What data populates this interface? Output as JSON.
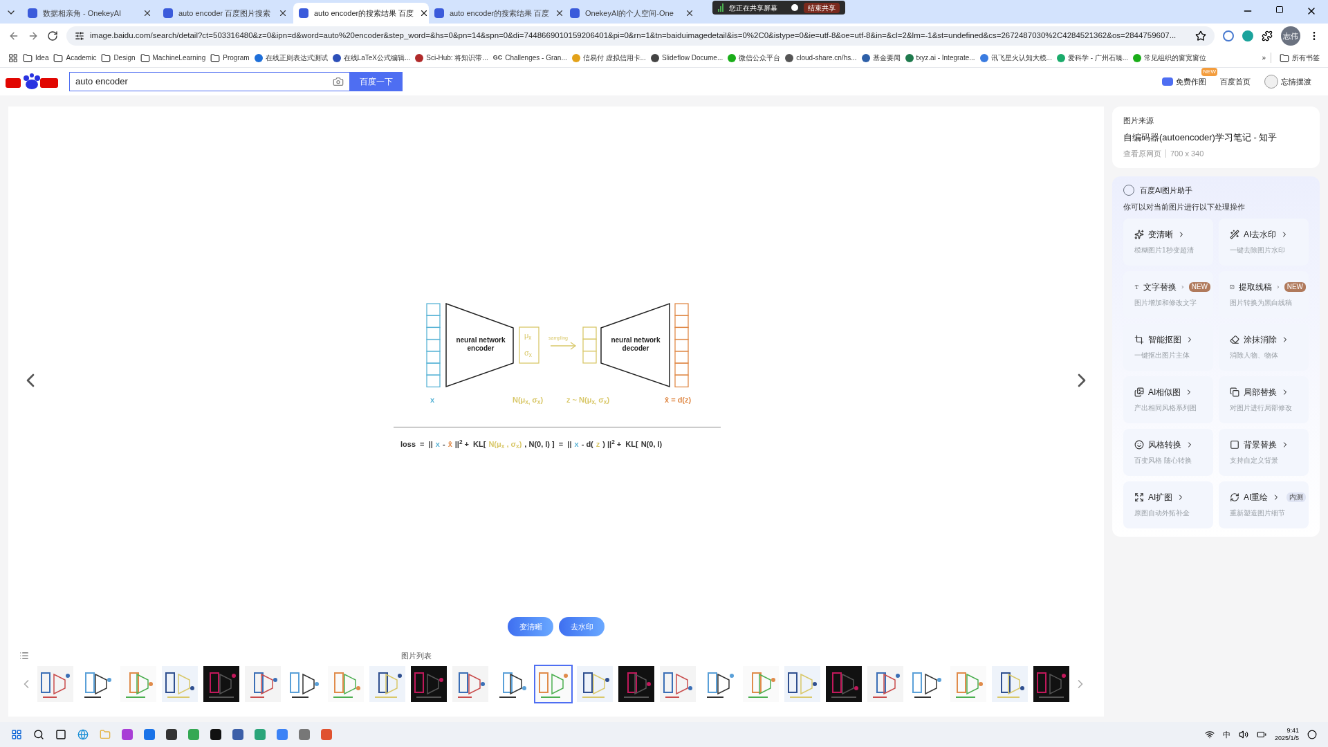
{
  "tabs": [
    {
      "title": "数据相亲角 - OnekeyAI",
      "selected": false
    },
    {
      "title": "auto encoder 百度图片搜索",
      "selected": false
    },
    {
      "title": "auto encoder的搜索结果 百度",
      "selected": true
    },
    {
      "title": "auto encoder的搜索结果 百度",
      "selected": false
    },
    {
      "title": "OnekeyAI的个人空间-One",
      "selected": false
    }
  ],
  "screen_share": {
    "message": "您正在共享屏幕",
    "stop_button": "结束共享"
  },
  "address_bar": {
    "url": "image.baidu.com/search/detail?ct=503316480&z=0&ipn=d&word=auto%20encoder&step_word=&hs=0&pn=14&spn=0&di=7448669010159206401&pi=0&rn=1&tn=baiduimagedetail&is=0%2C0&istype=0&ie=utf-8&oe=utf-8&in=&cl=2&lm=-1&st=undefined&cs=2672487030%2C4284521362&os=2844759607..."
  },
  "profile": {
    "label": "志伟"
  },
  "bookmarks": [
    {
      "kind": "folder",
      "label": "Idea"
    },
    {
      "kind": "folder",
      "label": "Academic"
    },
    {
      "kind": "folder",
      "label": "Design"
    },
    {
      "kind": "folder",
      "label": "MachineLearning"
    },
    {
      "kind": "folder",
      "label": "Program"
    },
    {
      "kind": "site",
      "label": "在线正则表达式测试",
      "color": "#1e6fd9"
    },
    {
      "kind": "site",
      "label": "在线LaTeX公式编辑...",
      "color": "#2c4fb8"
    },
    {
      "kind": "site",
      "label": "Sci-Hub: 将知识带...",
      "color": "#b02a2a"
    },
    {
      "kind": "code",
      "label": "Challenges - Gran...",
      "code": "GC"
    },
    {
      "kind": "site",
      "label": "信易付 虚拟信用卡...",
      "color": "#e3a21a"
    },
    {
      "kind": "site",
      "label": "Slideflow Docume...",
      "color": "#444444"
    },
    {
      "kind": "site",
      "label": "微信公众平台",
      "color": "#1aad19"
    },
    {
      "kind": "site",
      "label": "cloud-share.cn/hs...",
      "color": "#555555"
    },
    {
      "kind": "site",
      "label": "基金要闻",
      "color": "#2d5fa8"
    },
    {
      "kind": "site",
      "label": "txyz.ai - Integrate...",
      "color": "#1f7a4d"
    },
    {
      "kind": "site",
      "label": "讯飞星火认知大模...",
      "color": "#3a7be0"
    },
    {
      "kind": "site",
      "label": "爱科学 - 广州石臻...",
      "color": "#1bab6b"
    },
    {
      "kind": "site",
      "label": "常见组织的窗宽窗位",
      "color": "#1aad19"
    }
  ],
  "bookmarks_more": "»",
  "all_bookmarks": "所有书签",
  "search": {
    "value": "auto encoder",
    "button": "百度一下"
  },
  "header_links": [
    {
      "label": "免费作图",
      "badge": "NEW"
    },
    {
      "label": "百度首页"
    },
    {
      "label": "忘情摆渡"
    }
  ],
  "diagram": {
    "encoder": "neural network encoder",
    "decoder": "neural network decoder",
    "mu": "μ$_{x}$",
    "sigma": "σ$_{x}$",
    "sampling": "sampling",
    "x_label": "x",
    "dist_label": "N(μ$_{x,}$ σ$_{x}$)",
    "z_label": "z ~ N(μ$_{x,}$ σ$_{x}$)",
    "xhat_label": "x̂ = d(z)",
    "formula": [
      {
        "text": "loss  =  ||"
      },
      {
        "text": "x",
        "color": "#5ab4d6"
      },
      {
        "text": "-"
      },
      {
        "text": "x̂",
        "color": "#e08b4a"
      },
      {
        "text": "||$^{2}$ +  KL["
      },
      {
        "text": "N(μ$_{x}$ , σ$_{x}$)",
        "color": "#d9c86a"
      },
      {
        "text": ", N(0, I) ]  =  ||"
      },
      {
        "text": "x",
        "color": "#5ab4d6"
      },
      {
        "text": "- d("
      },
      {
        "text": "z",
        "color": "#d9c86a"
      },
      {
        "text": ") ||$^{2}$ +  KL["
      },
      {
        "text": "N(0, I)"
      }
    ]
  },
  "image_actions": [
    "变清晰",
    "去水印"
  ],
  "source": {
    "label": "图片来源",
    "title": "自编码器(autoencoder)学习笔记 - 知乎",
    "link": "查看原网页",
    "size": "700 x 340"
  },
  "assistant": {
    "title": "百度AI图片助手",
    "subtitle": "你可以对当前图片进行以下处理操作",
    "tools": [
      {
        "name": "变清晰",
        "desc": "模糊图片1秒变超清"
      },
      {
        "name": "AI去水印",
        "desc": "一键去除图片水印"
      },
      {
        "name": "文字替换",
        "desc": "图片增加和修改文字",
        "badge": "NEW"
      },
      {
        "name": "提取线稿",
        "desc": "图片转换为黑白线稿",
        "badge": "NEW"
      },
      {
        "name": "智能抠图",
        "desc": "一键抠出图片主体"
      },
      {
        "name": "涂抹消除",
        "desc": "消除人物、物体"
      },
      {
        "name": "AI相似图",
        "desc": "产出相同风格系列图"
      },
      {
        "name": "局部替换",
        "desc": "对图片进行局部修改"
      },
      {
        "name": "风格转换",
        "desc": "百变风格 随心转换"
      },
      {
        "name": "背景替换",
        "desc": "支持自定义背景"
      },
      {
        "name": "AI扩图",
        "desc": "原图自动外拓补全"
      },
      {
        "name": "AI重绘",
        "desc": "重新塑造图片细节",
        "badge": "内测"
      }
    ]
  },
  "strip": {
    "label": "图片列表",
    "thumbnails": [
      {
        "selected": false
      },
      {
        "selected": false
      },
      {
        "selected": false
      },
      {
        "selected": false
      },
      {
        "selected": false
      },
      {
        "selected": false
      },
      {
        "selected": false
      },
      {
        "selected": false
      },
      {
        "selected": false
      },
      {
        "selected": false
      },
      {
        "selected": false
      },
      {
        "selected": false
      },
      {
        "selected": true
      },
      {
        "selected": false
      },
      {
        "selected": false
      },
      {
        "selected": false
      },
      {
        "selected": false
      },
      {
        "selected": false
      },
      {
        "selected": false
      },
      {
        "selected": false
      },
      {
        "selected": false
      },
      {
        "selected": false
      },
      {
        "selected": false
      },
      {
        "selected": false
      },
      {
        "selected": false
      }
    ]
  },
  "taskbar": {
    "ime": "中",
    "time": "9:41",
    "date": "2025/1/5"
  }
}
